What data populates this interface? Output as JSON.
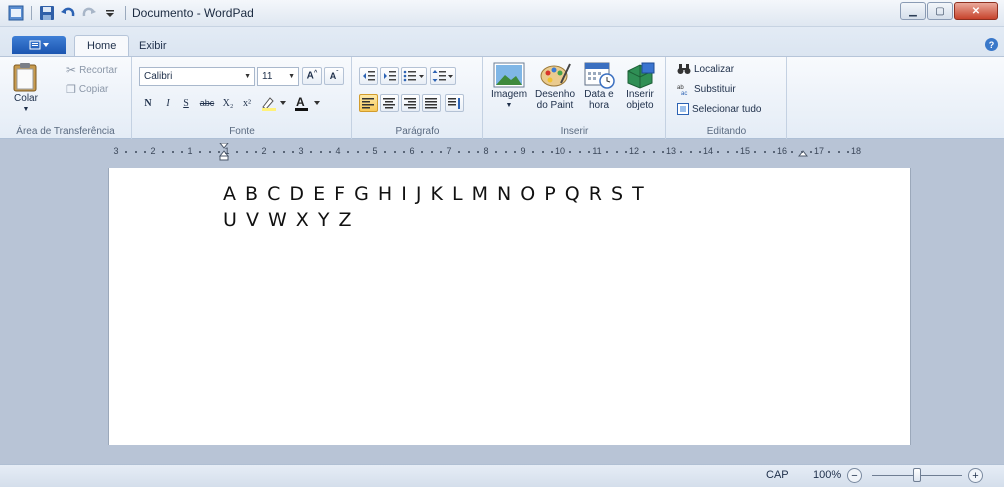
{
  "window": {
    "title": "Documento - WordPad"
  },
  "tabs": {
    "home": "Home",
    "view": "Exibir"
  },
  "ribbon": {
    "clipboard": {
      "paste": "Colar",
      "cut": "Recortar",
      "copy": "Copiar",
      "label": "Área de Transferência"
    },
    "font": {
      "family": "Calibri",
      "size": "11",
      "bold": "N",
      "italic": "I",
      "underline": "S",
      "strike": "abc",
      "subscript": "X₂",
      "superscript": "x²",
      "label": "Fonte"
    },
    "paragraph": {
      "label": "Parágrafo"
    },
    "insert": {
      "image": "Imagem",
      "paint_line1": "Desenho",
      "paint_line2": "do Paint",
      "datetime_line1": "Data e",
      "datetime_line2": "hora",
      "object_line1": "Inserir",
      "object_line2": "objeto",
      "label": "Inserir"
    },
    "editing": {
      "find": "Localizar",
      "replace": "Substituir",
      "select_all": "Selecionar tudo",
      "label": "Editando"
    }
  },
  "ruler": {
    "labels": [
      "3",
      "2",
      "1",
      "1",
      "2",
      "3",
      "4",
      "5",
      "6",
      "7",
      "8",
      "9",
      "10",
      "11",
      "12",
      "13",
      "14",
      "15",
      "16",
      "17",
      "18"
    ]
  },
  "document": {
    "line1": "A B C D E F G H I J K L M N O P Q R S T",
    "line2": "U V W X Y Z"
  },
  "statusbar": {
    "caps": "CAP",
    "zoom": "100%",
    "zoom_level": 0.5
  },
  "colors": {
    "accent": "#1b55b0",
    "ribbon_bg": "#e4ecf6",
    "workspace": "#b8c4d6"
  }
}
